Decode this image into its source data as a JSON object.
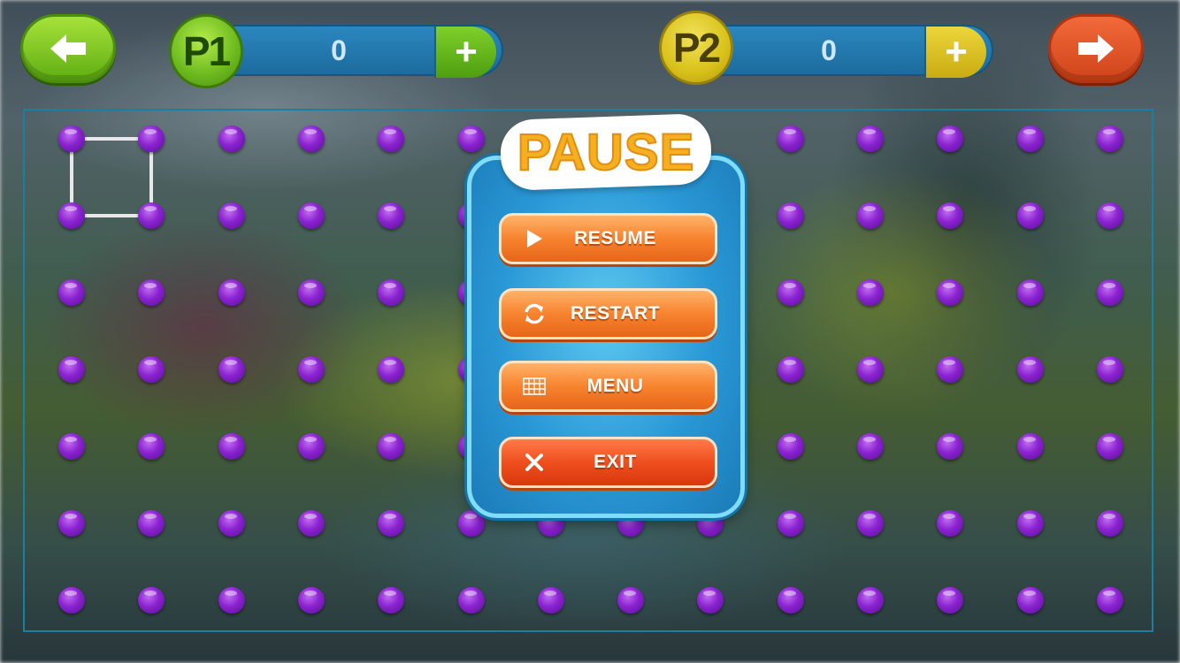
{
  "header": {
    "back_icon": "arrow-left-icon",
    "next_icon": "arrow-right-icon",
    "players": [
      {
        "badge": "P1",
        "score": "0",
        "plus": "+",
        "color": "#6ab81e"
      },
      {
        "badge": "P2",
        "score": "0",
        "plus": "+",
        "color": "#d8c11a"
      }
    ]
  },
  "board": {
    "rows": 7,
    "cols": 14,
    "dot_color": "#8a23d0",
    "drawn_lines": [
      {
        "from": [
          0,
          0
        ],
        "to": [
          0,
          1
        ]
      },
      {
        "from": [
          0,
          0
        ],
        "to": [
          1,
          0
        ]
      },
      {
        "from": [
          0,
          1
        ],
        "to": [
          1,
          1
        ]
      },
      {
        "from": [
          1,
          0
        ],
        "to": [
          1,
          1
        ]
      }
    ]
  },
  "pause_menu": {
    "title": "PAUSE",
    "buttons": [
      {
        "label": "RESUME",
        "icon": "play-icon"
      },
      {
        "label": "RESTART",
        "icon": "restart-icon"
      },
      {
        "label": "MENU",
        "icon": "grid-icon"
      },
      {
        "label": "EXIT",
        "icon": "close-icon"
      }
    ]
  }
}
